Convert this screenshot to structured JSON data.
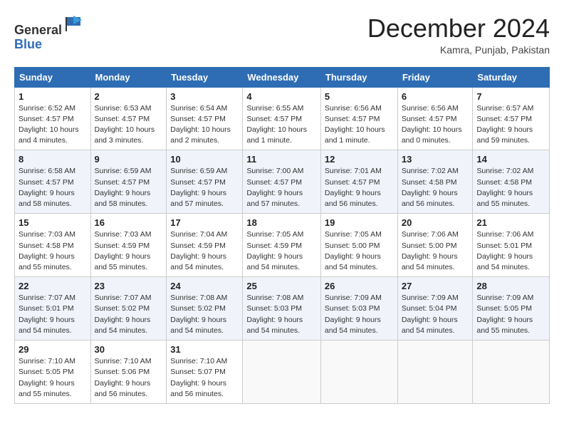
{
  "header": {
    "logo_line1": "General",
    "logo_line2": "Blue",
    "month": "December 2024",
    "location": "Kamra, Punjab, Pakistan"
  },
  "weekdays": [
    "Sunday",
    "Monday",
    "Tuesday",
    "Wednesday",
    "Thursday",
    "Friday",
    "Saturday"
  ],
  "weeks": [
    [
      {
        "day": "1",
        "sunrise": "6:52 AM",
        "sunset": "4:57 PM",
        "daylight": "10 hours and 4 minutes."
      },
      {
        "day": "2",
        "sunrise": "6:53 AM",
        "sunset": "4:57 PM",
        "daylight": "10 hours and 3 minutes."
      },
      {
        "day": "3",
        "sunrise": "6:54 AM",
        "sunset": "4:57 PM",
        "daylight": "10 hours and 2 minutes."
      },
      {
        "day": "4",
        "sunrise": "6:55 AM",
        "sunset": "4:57 PM",
        "daylight": "10 hours and 1 minute."
      },
      {
        "day": "5",
        "sunrise": "6:56 AM",
        "sunset": "4:57 PM",
        "daylight": "10 hours and 1 minute."
      },
      {
        "day": "6",
        "sunrise": "6:56 AM",
        "sunset": "4:57 PM",
        "daylight": "10 hours and 0 minutes."
      },
      {
        "day": "7",
        "sunrise": "6:57 AM",
        "sunset": "4:57 PM",
        "daylight": "9 hours and 59 minutes."
      }
    ],
    [
      {
        "day": "8",
        "sunrise": "6:58 AM",
        "sunset": "4:57 PM",
        "daylight": "9 hours and 58 minutes."
      },
      {
        "day": "9",
        "sunrise": "6:59 AM",
        "sunset": "4:57 PM",
        "daylight": "9 hours and 58 minutes."
      },
      {
        "day": "10",
        "sunrise": "6:59 AM",
        "sunset": "4:57 PM",
        "daylight": "9 hours and 57 minutes."
      },
      {
        "day": "11",
        "sunrise": "7:00 AM",
        "sunset": "4:57 PM",
        "daylight": "9 hours and 57 minutes."
      },
      {
        "day": "12",
        "sunrise": "7:01 AM",
        "sunset": "4:57 PM",
        "daylight": "9 hours and 56 minutes."
      },
      {
        "day": "13",
        "sunrise": "7:02 AM",
        "sunset": "4:58 PM",
        "daylight": "9 hours and 56 minutes."
      },
      {
        "day": "14",
        "sunrise": "7:02 AM",
        "sunset": "4:58 PM",
        "daylight": "9 hours and 55 minutes."
      }
    ],
    [
      {
        "day": "15",
        "sunrise": "7:03 AM",
        "sunset": "4:58 PM",
        "daylight": "9 hours and 55 minutes."
      },
      {
        "day": "16",
        "sunrise": "7:03 AM",
        "sunset": "4:59 PM",
        "daylight": "9 hours and 55 minutes."
      },
      {
        "day": "17",
        "sunrise": "7:04 AM",
        "sunset": "4:59 PM",
        "daylight": "9 hours and 54 minutes."
      },
      {
        "day": "18",
        "sunrise": "7:05 AM",
        "sunset": "4:59 PM",
        "daylight": "9 hours and 54 minutes."
      },
      {
        "day": "19",
        "sunrise": "7:05 AM",
        "sunset": "5:00 PM",
        "daylight": "9 hours and 54 minutes."
      },
      {
        "day": "20",
        "sunrise": "7:06 AM",
        "sunset": "5:00 PM",
        "daylight": "9 hours and 54 minutes."
      },
      {
        "day": "21",
        "sunrise": "7:06 AM",
        "sunset": "5:01 PM",
        "daylight": "9 hours and 54 minutes."
      }
    ],
    [
      {
        "day": "22",
        "sunrise": "7:07 AM",
        "sunset": "5:01 PM",
        "daylight": "9 hours and 54 minutes."
      },
      {
        "day": "23",
        "sunrise": "7:07 AM",
        "sunset": "5:02 PM",
        "daylight": "9 hours and 54 minutes."
      },
      {
        "day": "24",
        "sunrise": "7:08 AM",
        "sunset": "5:02 PM",
        "daylight": "9 hours and 54 minutes."
      },
      {
        "day": "25",
        "sunrise": "7:08 AM",
        "sunset": "5:03 PM",
        "daylight": "9 hours and 54 minutes."
      },
      {
        "day": "26",
        "sunrise": "7:09 AM",
        "sunset": "5:03 PM",
        "daylight": "9 hours and 54 minutes."
      },
      {
        "day": "27",
        "sunrise": "7:09 AM",
        "sunset": "5:04 PM",
        "daylight": "9 hours and 54 minutes."
      },
      {
        "day": "28",
        "sunrise": "7:09 AM",
        "sunset": "5:05 PM",
        "daylight": "9 hours and 55 minutes."
      }
    ],
    [
      {
        "day": "29",
        "sunrise": "7:10 AM",
        "sunset": "5:05 PM",
        "daylight": "9 hours and 55 minutes."
      },
      {
        "day": "30",
        "sunrise": "7:10 AM",
        "sunset": "5:06 PM",
        "daylight": "9 hours and 56 minutes."
      },
      {
        "day": "31",
        "sunrise": "7:10 AM",
        "sunset": "5:07 PM",
        "daylight": "9 hours and 56 minutes."
      },
      null,
      null,
      null,
      null
    ]
  ]
}
